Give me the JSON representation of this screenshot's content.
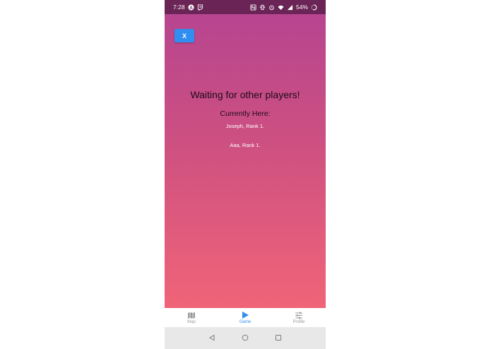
{
  "statusbar": {
    "time": "7:28",
    "battery": "54%"
  },
  "screen": {
    "close_label": "X",
    "title": "Waiting for other players!",
    "subtitle": "Currently Here:",
    "players": [
      "Joseph, Rank 1.",
      "Aaa, Rank 1."
    ]
  },
  "nav": {
    "items": [
      {
        "label": "Map",
        "icon": "map-icon",
        "active": false
      },
      {
        "label": "Game",
        "icon": "play-icon",
        "active": true
      },
      {
        "label": "Profile",
        "icon": "sliders-icon",
        "active": false
      }
    ]
  },
  "colors": {
    "gradient_top": "#b7458f",
    "gradient_bottom": "#f06478",
    "accent": "#2f8ef0",
    "statusbar": "#6a2456"
  }
}
